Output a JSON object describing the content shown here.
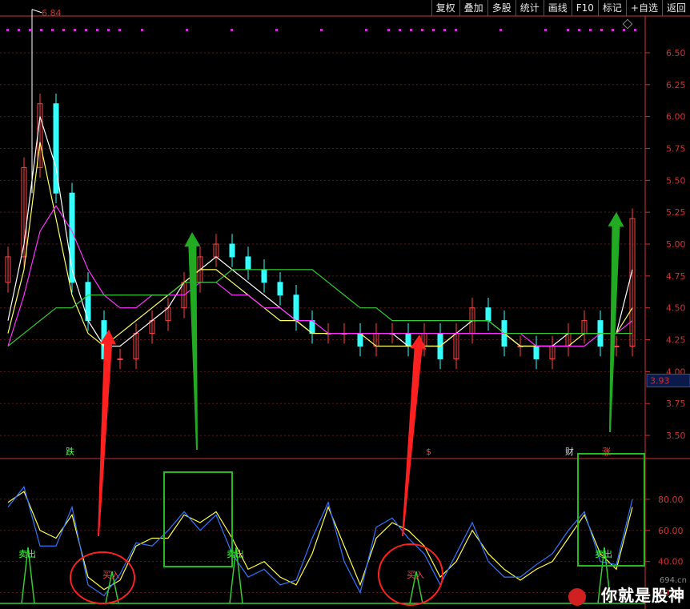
{
  "toolbar": {
    "buttons": [
      {
        "label": "复权",
        "name": "restore-rights-button"
      },
      {
        "label": "叠加",
        "name": "overlay-button"
      },
      {
        "label": "多股",
        "name": "multi-stock-button"
      },
      {
        "label": "统计",
        "name": "statistics-button"
      },
      {
        "label": "画线",
        "name": "draw-line-button"
      },
      {
        "label": "F10",
        "name": "f10-button"
      },
      {
        "label": "标记",
        "name": "mark-button"
      },
      {
        "label": "+自选",
        "name": "add-watchlist-button"
      },
      {
        "label": "返回",
        "name": "back-button"
      }
    ]
  },
  "price_axis": {
    "ticks": [
      "6.50",
      "6.25",
      "6.00",
      "5.75",
      "5.50",
      "5.25",
      "5.00",
      "4.75",
      "4.50",
      "4.25",
      "4.00",
      "3.75",
      "3.50"
    ],
    "current_price_label": "3.93",
    "high_label": "6.84"
  },
  "indicator_axis": {
    "ticks": [
      "80.00",
      "60.00",
      "40.00",
      "20.00"
    ]
  },
  "markers": {
    "die": "跌",
    "dollar": "$",
    "cai": "财",
    "zhang": "涨"
  },
  "signals": {
    "sell": "卖出",
    "buy": "买入"
  },
  "watermark": {
    "text": "你就是股神",
    "sub": "694.cn"
  },
  "colors": {
    "background": "#000000",
    "up": "#ff4444",
    "down": "#33ffff",
    "ma5": "#ffffff",
    "ma10": "#ffff66",
    "ma20": "#ff33ff",
    "ma60": "#33cc33",
    "k_line": "#ffff44",
    "d_line": "#3377ff",
    "buy_arrow": "#ff2020",
    "sell_arrow": "#22aa22",
    "box": "#22bb22",
    "circle": "#ff2020"
  },
  "chart_data": [
    {
      "type": "candlestick",
      "ylim": [
        3.4,
        6.6
      ],
      "price_high": 6.84,
      "last_price": 3.93,
      "series": [
        {
          "name": "close",
          "values": [
            4.9,
            5.6,
            6.1,
            5.4,
            4.7,
            4.4,
            4.1,
            4.1,
            4.3,
            4.4,
            4.5,
            4.7,
            4.9,
            5.0,
            4.9,
            4.8,
            4.7,
            4.6,
            4.4,
            4.3,
            4.3,
            4.3,
            4.2,
            4.3,
            4.3,
            4.2,
            4.3,
            4.1,
            4.3,
            4.5,
            4.4,
            4.2,
            4.2,
            4.1,
            4.2,
            4.3,
            4.4,
            4.2,
            4.2,
            5.2
          ]
        },
        {
          "name": "ma5",
          "values": [
            4.4,
            5.0,
            6.0,
            5.6,
            4.8,
            4.4,
            4.2,
            4.2,
            4.3,
            4.4,
            4.5,
            4.7,
            4.8,
            4.9,
            4.8,
            4.7,
            4.6,
            4.5,
            4.4,
            4.3,
            4.3,
            4.3,
            4.3,
            4.3,
            4.3,
            4.2,
            4.2,
            4.2,
            4.3,
            4.4,
            4.4,
            4.3,
            4.2,
            4.2,
            4.2,
            4.3,
            4.3,
            4.3,
            4.3,
            4.8
          ]
        },
        {
          "name": "ma10",
          "values": [
            4.3,
            4.8,
            5.8,
            5.2,
            4.6,
            4.3,
            4.2,
            4.3,
            4.4,
            4.5,
            4.6,
            4.7,
            4.8,
            4.8,
            4.7,
            4.6,
            4.5,
            4.4,
            4.4,
            4.3,
            4.3,
            4.3,
            4.3,
            4.2,
            4.2,
            4.2,
            4.2,
            4.2,
            4.3,
            4.3,
            4.3,
            4.3,
            4.2,
            4.2,
            4.2,
            4.2,
            4.3,
            4.3,
            4.3,
            4.5
          ]
        },
        {
          "name": "ma20",
          "values": [
            4.2,
            4.6,
            5.1,
            5.3,
            5.1,
            4.8,
            4.6,
            4.5,
            4.5,
            4.6,
            4.6,
            4.6,
            4.7,
            4.7,
            4.6,
            4.6,
            4.5,
            4.5,
            4.4,
            4.4,
            4.3,
            4.3,
            4.3,
            4.3,
            4.3,
            4.3,
            4.3,
            4.3,
            4.3,
            4.3,
            4.3,
            4.3,
            4.3,
            4.2,
            4.2,
            4.2,
            4.2,
            4.3,
            4.3,
            4.4
          ]
        },
        {
          "name": "ma60",
          "values": [
            4.2,
            4.3,
            4.4,
            4.5,
            4.5,
            4.6,
            4.6,
            4.6,
            4.6,
            4.6,
            4.6,
            4.7,
            4.7,
            4.7,
            4.8,
            4.8,
            4.8,
            4.8,
            4.8,
            4.8,
            4.7,
            4.6,
            4.5,
            4.5,
            4.4,
            4.4,
            4.4,
            4.4,
            4.4,
            4.4,
            4.4,
            4.3,
            4.3,
            4.3,
            4.3,
            4.3,
            4.3,
            4.3,
            4.3,
            4.3
          ]
        }
      ]
    },
    {
      "type": "line",
      "ylim": [
        10,
        100
      ],
      "yticks": [
        80,
        60,
        40,
        20
      ],
      "series": [
        {
          "name": "K",
          "values": [
            78,
            85,
            60,
            55,
            70,
            30,
            22,
            28,
            50,
            55,
            55,
            70,
            65,
            72,
            55,
            35,
            40,
            30,
            25,
            45,
            75,
            50,
            25,
            55,
            65,
            60,
            50,
            30,
            40,
            60,
            45,
            35,
            28,
            35,
            40,
            55,
            70,
            45,
            35,
            75
          ]
        },
        {
          "name": "D",
          "values": [
            75,
            88,
            50,
            50,
            75,
            25,
            18,
            32,
            52,
            50,
            60,
            72,
            60,
            70,
            45,
            30,
            35,
            25,
            28,
            55,
            78,
            40,
            20,
            62,
            68,
            55,
            45,
            25,
            45,
            65,
            40,
            30,
            30,
            38,
            45,
            60,
            72,
            40,
            38,
            80
          ]
        }
      ]
    }
  ]
}
